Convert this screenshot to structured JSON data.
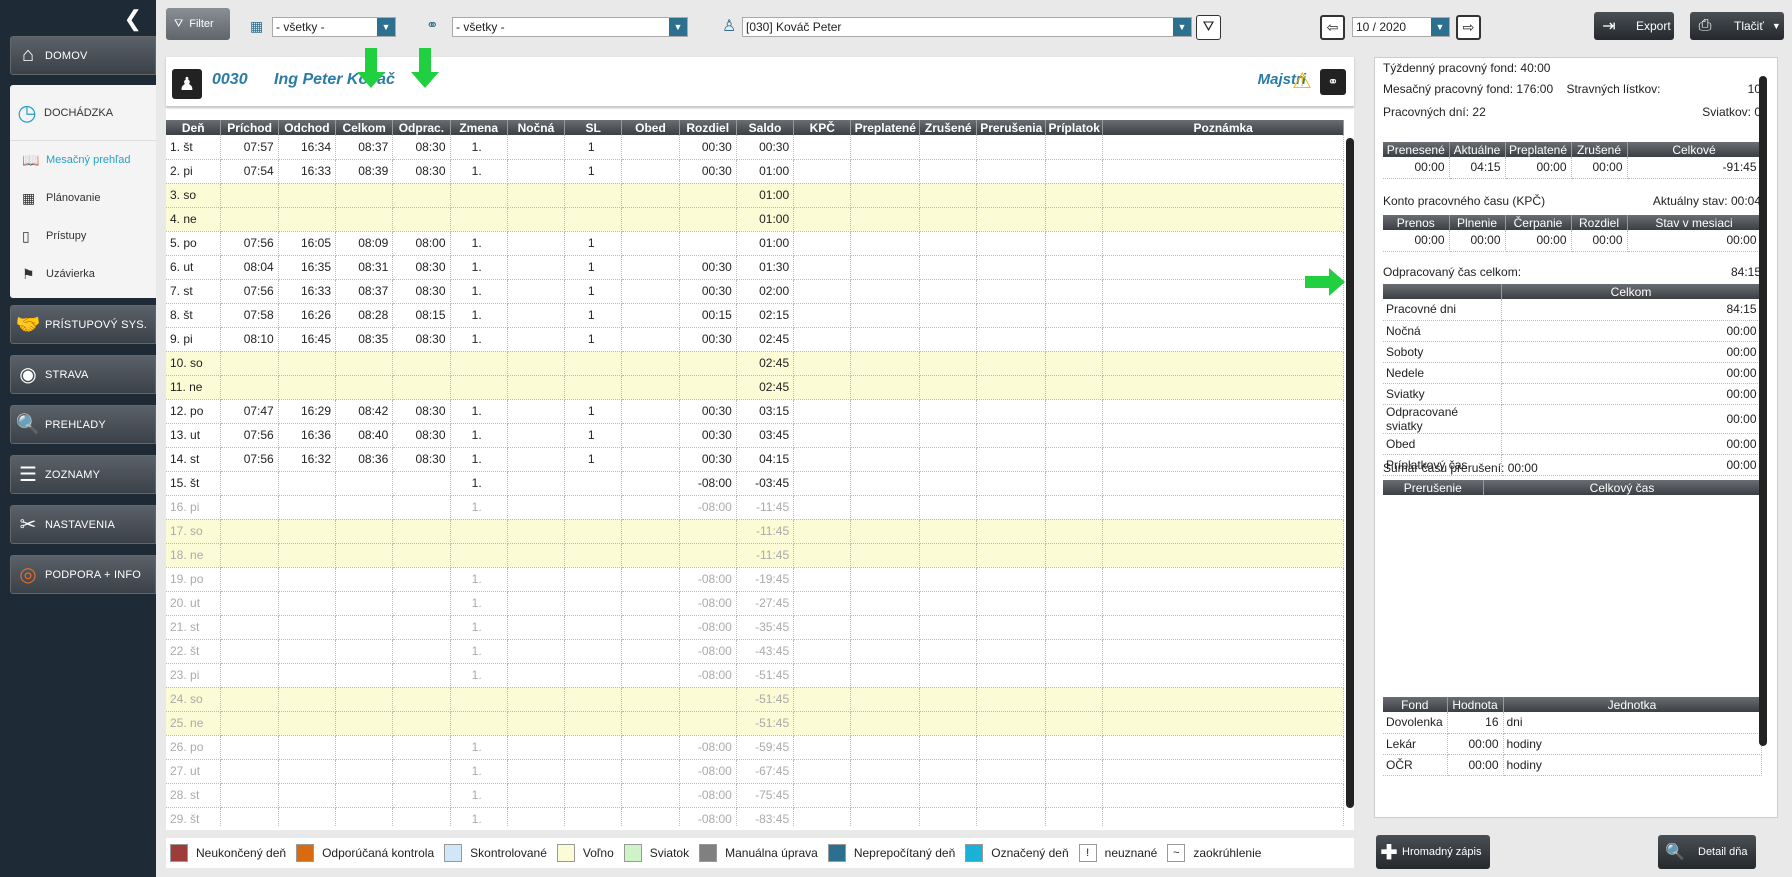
{
  "sidebar": {
    "items": [
      {
        "icon": "home-icon",
        "label": "DOMOV"
      },
      {
        "icon": "clock-icon",
        "label": "DOCHÁDZKA"
      },
      {
        "icon": "handshake-icon",
        "label": "PRÍSTUPOVÝ SYS."
      },
      {
        "icon": "plate-icon",
        "label": "STRAVA"
      },
      {
        "icon": "report-icon",
        "label": "PREHĽADY"
      },
      {
        "icon": "list-icon",
        "label": "ZOZNAMY"
      },
      {
        "icon": "tools-icon",
        "label": "NASTAVENIA"
      },
      {
        "icon": "lifebuoy-icon",
        "label": "PODPORA + INFO"
      }
    ],
    "sub": [
      {
        "label": "Mesačný prehľad"
      },
      {
        "label": "Plánovanie"
      },
      {
        "label": "Prístupy"
      },
      {
        "label": "Uzávierka"
      }
    ]
  },
  "topbar": {
    "filter": "Filter",
    "org": "- všetky -",
    "struct": "- všetky -",
    "employee": "[030] Kováč Peter",
    "period": "10 / 2020",
    "export": "Export",
    "print": "Tlačiť"
  },
  "employee": {
    "code": "0030",
    "name": "Ing Peter Kováč",
    "dept": "Majstri"
  },
  "columns": [
    "Deň",
    "Príchod",
    "Odchod",
    "Celkom",
    "Odprac.",
    "Zmena",
    "Nočná",
    "SL",
    "Obed",
    "Rozdiel",
    "Saldo",
    "KPČ",
    "Preplatené",
    "Zrušené",
    "Prerušenia",
    "Príplatok",
    "Poznámka"
  ],
  "rows": [
    {
      "d": "1. št",
      "p": "07:57",
      "o": "16:34",
      "c": "08:37",
      "op": "08:30",
      "z": "1.",
      "sl": "1",
      "r": "00:30",
      "s": "00:30",
      "t": "n"
    },
    {
      "d": "2. pi",
      "p": "07:54",
      "o": "16:33",
      "c": "08:39",
      "op": "08:30",
      "z": "1.",
      "sl": "1",
      "r": "00:30",
      "s": "01:00",
      "t": "n"
    },
    {
      "d": "3. so",
      "p": "",
      "o": "",
      "c": "",
      "op": "",
      "z": "",
      "sl": "",
      "r": "",
      "s": "01:00",
      "t": "we"
    },
    {
      "d": "4. ne",
      "p": "",
      "o": "",
      "c": "",
      "op": "",
      "z": "",
      "sl": "",
      "r": "",
      "s": "01:00",
      "t": "we"
    },
    {
      "d": "5. po",
      "p": "07:56",
      "o": "16:05",
      "c": "08:09",
      "op": "08:00",
      "z": "1.",
      "sl": "1",
      "r": "",
      "s": "01:00",
      "t": "n"
    },
    {
      "d": "6. ut",
      "p": "08:04",
      "o": "16:35",
      "c": "08:31",
      "op": "08:30",
      "z": "1.",
      "sl": "1",
      "r": "00:30",
      "s": "01:30",
      "t": "n"
    },
    {
      "d": "7. st",
      "p": "07:56",
      "o": "16:33",
      "c": "08:37",
      "op": "08:30",
      "z": "1.",
      "sl": "1",
      "r": "00:30",
      "s": "02:00",
      "t": "n"
    },
    {
      "d": "8. št",
      "p": "07:58",
      "o": "16:26",
      "c": "08:28",
      "op": "08:15",
      "z": "1.",
      "sl": "1",
      "r": "00:15",
      "s": "02:15",
      "t": "n"
    },
    {
      "d": "9. pi",
      "p": "08:10",
      "o": "16:45",
      "c": "08:35",
      "op": "08:30",
      "z": "1.",
      "sl": "1",
      "r": "00:30",
      "s": "02:45",
      "t": "n"
    },
    {
      "d": "10. so",
      "p": "",
      "o": "",
      "c": "",
      "op": "",
      "z": "",
      "sl": "",
      "r": "",
      "s": "02:45",
      "t": "we"
    },
    {
      "d": "11. ne",
      "p": "",
      "o": "",
      "c": "",
      "op": "",
      "z": "",
      "sl": "",
      "r": "",
      "s": "02:45",
      "t": "we"
    },
    {
      "d": "12. po",
      "p": "07:47",
      "o": "16:29",
      "c": "08:42",
      "op": "08:30",
      "z": "1.",
      "sl": "1",
      "r": "00:30",
      "s": "03:15",
      "t": "n"
    },
    {
      "d": "13. ut",
      "p": "07:56",
      "o": "16:36",
      "c": "08:40",
      "op": "08:30",
      "z": "1.",
      "sl": "1",
      "r": "00:30",
      "s": "03:45",
      "t": "n"
    },
    {
      "d": "14. st",
      "p": "07:56",
      "o": "16:32",
      "c": "08:36",
      "op": "08:30",
      "z": "1.",
      "sl": "1",
      "r": "00:30",
      "s": "04:15",
      "t": "n"
    },
    {
      "d": "15. št",
      "p": "",
      "o": "",
      "c": "",
      "op": "",
      "z": "1.",
      "sl": "",
      "r": "-08:00",
      "s": "-03:45",
      "t": "n"
    },
    {
      "d": "16. pi",
      "p": "",
      "o": "",
      "c": "",
      "op": "",
      "z": "1.",
      "sl": "",
      "r": "-08:00",
      "s": "-11:45",
      "t": "fut"
    },
    {
      "d": "17. so",
      "p": "",
      "o": "",
      "c": "",
      "op": "",
      "z": "",
      "sl": "",
      "r": "",
      "s": "-11:45",
      "t": "fwe"
    },
    {
      "d": "18. ne",
      "p": "",
      "o": "",
      "c": "",
      "op": "",
      "z": "",
      "sl": "",
      "r": "",
      "s": "-11:45",
      "t": "fwe"
    },
    {
      "d": "19. po",
      "p": "",
      "o": "",
      "c": "",
      "op": "",
      "z": "1.",
      "sl": "",
      "r": "-08:00",
      "s": "-19:45",
      "t": "fut"
    },
    {
      "d": "20. ut",
      "p": "",
      "o": "",
      "c": "",
      "op": "",
      "z": "1.",
      "sl": "",
      "r": "-08:00",
      "s": "-27:45",
      "t": "fut"
    },
    {
      "d": "21. st",
      "p": "",
      "o": "",
      "c": "",
      "op": "",
      "z": "1.",
      "sl": "",
      "r": "-08:00",
      "s": "-35:45",
      "t": "fut"
    },
    {
      "d": "22. št",
      "p": "",
      "o": "",
      "c": "",
      "op": "",
      "z": "1.",
      "sl": "",
      "r": "-08:00",
      "s": "-43:45",
      "t": "fut"
    },
    {
      "d": "23. pi",
      "p": "",
      "o": "",
      "c": "",
      "op": "",
      "z": "1.",
      "sl": "",
      "r": "-08:00",
      "s": "-51:45",
      "t": "fut"
    },
    {
      "d": "24. so",
      "p": "",
      "o": "",
      "c": "",
      "op": "",
      "z": "",
      "sl": "",
      "r": "",
      "s": "-51:45",
      "t": "fwe"
    },
    {
      "d": "25. ne",
      "p": "",
      "o": "",
      "c": "",
      "op": "",
      "z": "",
      "sl": "",
      "r": "",
      "s": "-51:45",
      "t": "fwe"
    },
    {
      "d": "26. po",
      "p": "",
      "o": "",
      "c": "",
      "op": "",
      "z": "1.",
      "sl": "",
      "r": "-08:00",
      "s": "-59:45",
      "t": "fut"
    },
    {
      "d": "27. ut",
      "p": "",
      "o": "",
      "c": "",
      "op": "",
      "z": "1.",
      "sl": "",
      "r": "-08:00",
      "s": "-67:45",
      "t": "fut"
    },
    {
      "d": "28. st",
      "p": "",
      "o": "",
      "c": "",
      "op": "",
      "z": "1.",
      "sl": "",
      "r": "-08:00",
      "s": "-75:45",
      "t": "fut"
    },
    {
      "d": "29. št",
      "p": "",
      "o": "",
      "c": "",
      "op": "",
      "z": "1.",
      "sl": "",
      "r": "-08:00",
      "s": "-83:45",
      "t": "fut"
    }
  ],
  "right": {
    "tyz_label": "Týždenný pracovný fond:",
    "tyz_val": "40:00",
    "mes_label": "Mesačný pracovný fond:",
    "mes_val": "176:00",
    "strav_label": "Stravných lístkov:",
    "strav_val": "10",
    "prac_label": "Pracovných dní:",
    "prac_val": "22",
    "sviat_label": "Sviatkov:",
    "sviat_val": "0",
    "t1_head": [
      "Prenesené",
      "Aktuálne",
      "Preplatené",
      "Zrušené",
      "Celkové"
    ],
    "t1_row": [
      "00:00",
      "04:15",
      "00:00",
      "00:00",
      "-91:45"
    ],
    "kpc_label": "Konto pracovného času (KPČ)",
    "kpc_state": "Aktuálny stav:",
    "kpc_state_val": "00:04",
    "t2_head": [
      "Prenos",
      "Plnenie",
      "Čerpanie",
      "Rozdiel",
      "Stav v mesiaci"
    ],
    "t2_row": [
      "00:00",
      "00:00",
      "00:00",
      "00:00",
      "00:00"
    ],
    "odp_label": "Odpracovaný čas celkom:",
    "odp_val": "84:15",
    "t3_head": "Celkom",
    "t3_rows": [
      {
        "k": "Pracovné dni",
        "v": "84:15"
      },
      {
        "k": "Nočná",
        "v": "00:00"
      },
      {
        "k": "Soboty",
        "v": "00:00"
      },
      {
        "k": "Nedele",
        "v": "00:00"
      },
      {
        "k": "Sviatky",
        "v": "00:00"
      },
      {
        "k": "Odpracované sviatky",
        "v": "00:00"
      },
      {
        "k": "Obed",
        "v": "00:00"
      },
      {
        "k": "Príplatkový čas",
        "v": "00:00"
      }
    ],
    "sum_label": "Sumár času prerušení:",
    "sum_val": "00:00",
    "t4_head": [
      "Prerušenie",
      "Celkový čas"
    ],
    "t5_head": [
      "Fond",
      "Hodnota",
      "Jednotka"
    ],
    "t5_rows": [
      {
        "f": "Dovolenka",
        "h": "16",
        "j": "dni"
      },
      {
        "f": "Lekár",
        "h": "00:00",
        "j": "hodiny"
      },
      {
        "f": "OČR",
        "h": "00:00",
        "j": "hodiny"
      }
    ]
  },
  "legend": [
    {
      "color": "#9e3b3b",
      "label": "Neukončený deň"
    },
    {
      "color": "#d86a10",
      "label": "Odporúčaná kontrola"
    },
    {
      "color": "#cfe7f8",
      "label": "Skontrolované"
    },
    {
      "color": "#fbfbd5",
      "label": "Voľno"
    },
    {
      "color": "#cdf3c7",
      "label": "Sviatok"
    },
    {
      "color": "#808080",
      "label": "Manuálna úprava"
    },
    {
      "color": "#2d6f8e",
      "label": "Neprepočítaný deň"
    },
    {
      "color": "#1ab0d8",
      "label": "Označený deň"
    },
    {
      "sym": "!",
      "label": "neuznané"
    },
    {
      "sym": "~",
      "label": "zaokrúhlenie"
    }
  ],
  "buttons": {
    "bulk": "Hromadný zápis",
    "detail": "Detail dňa"
  }
}
